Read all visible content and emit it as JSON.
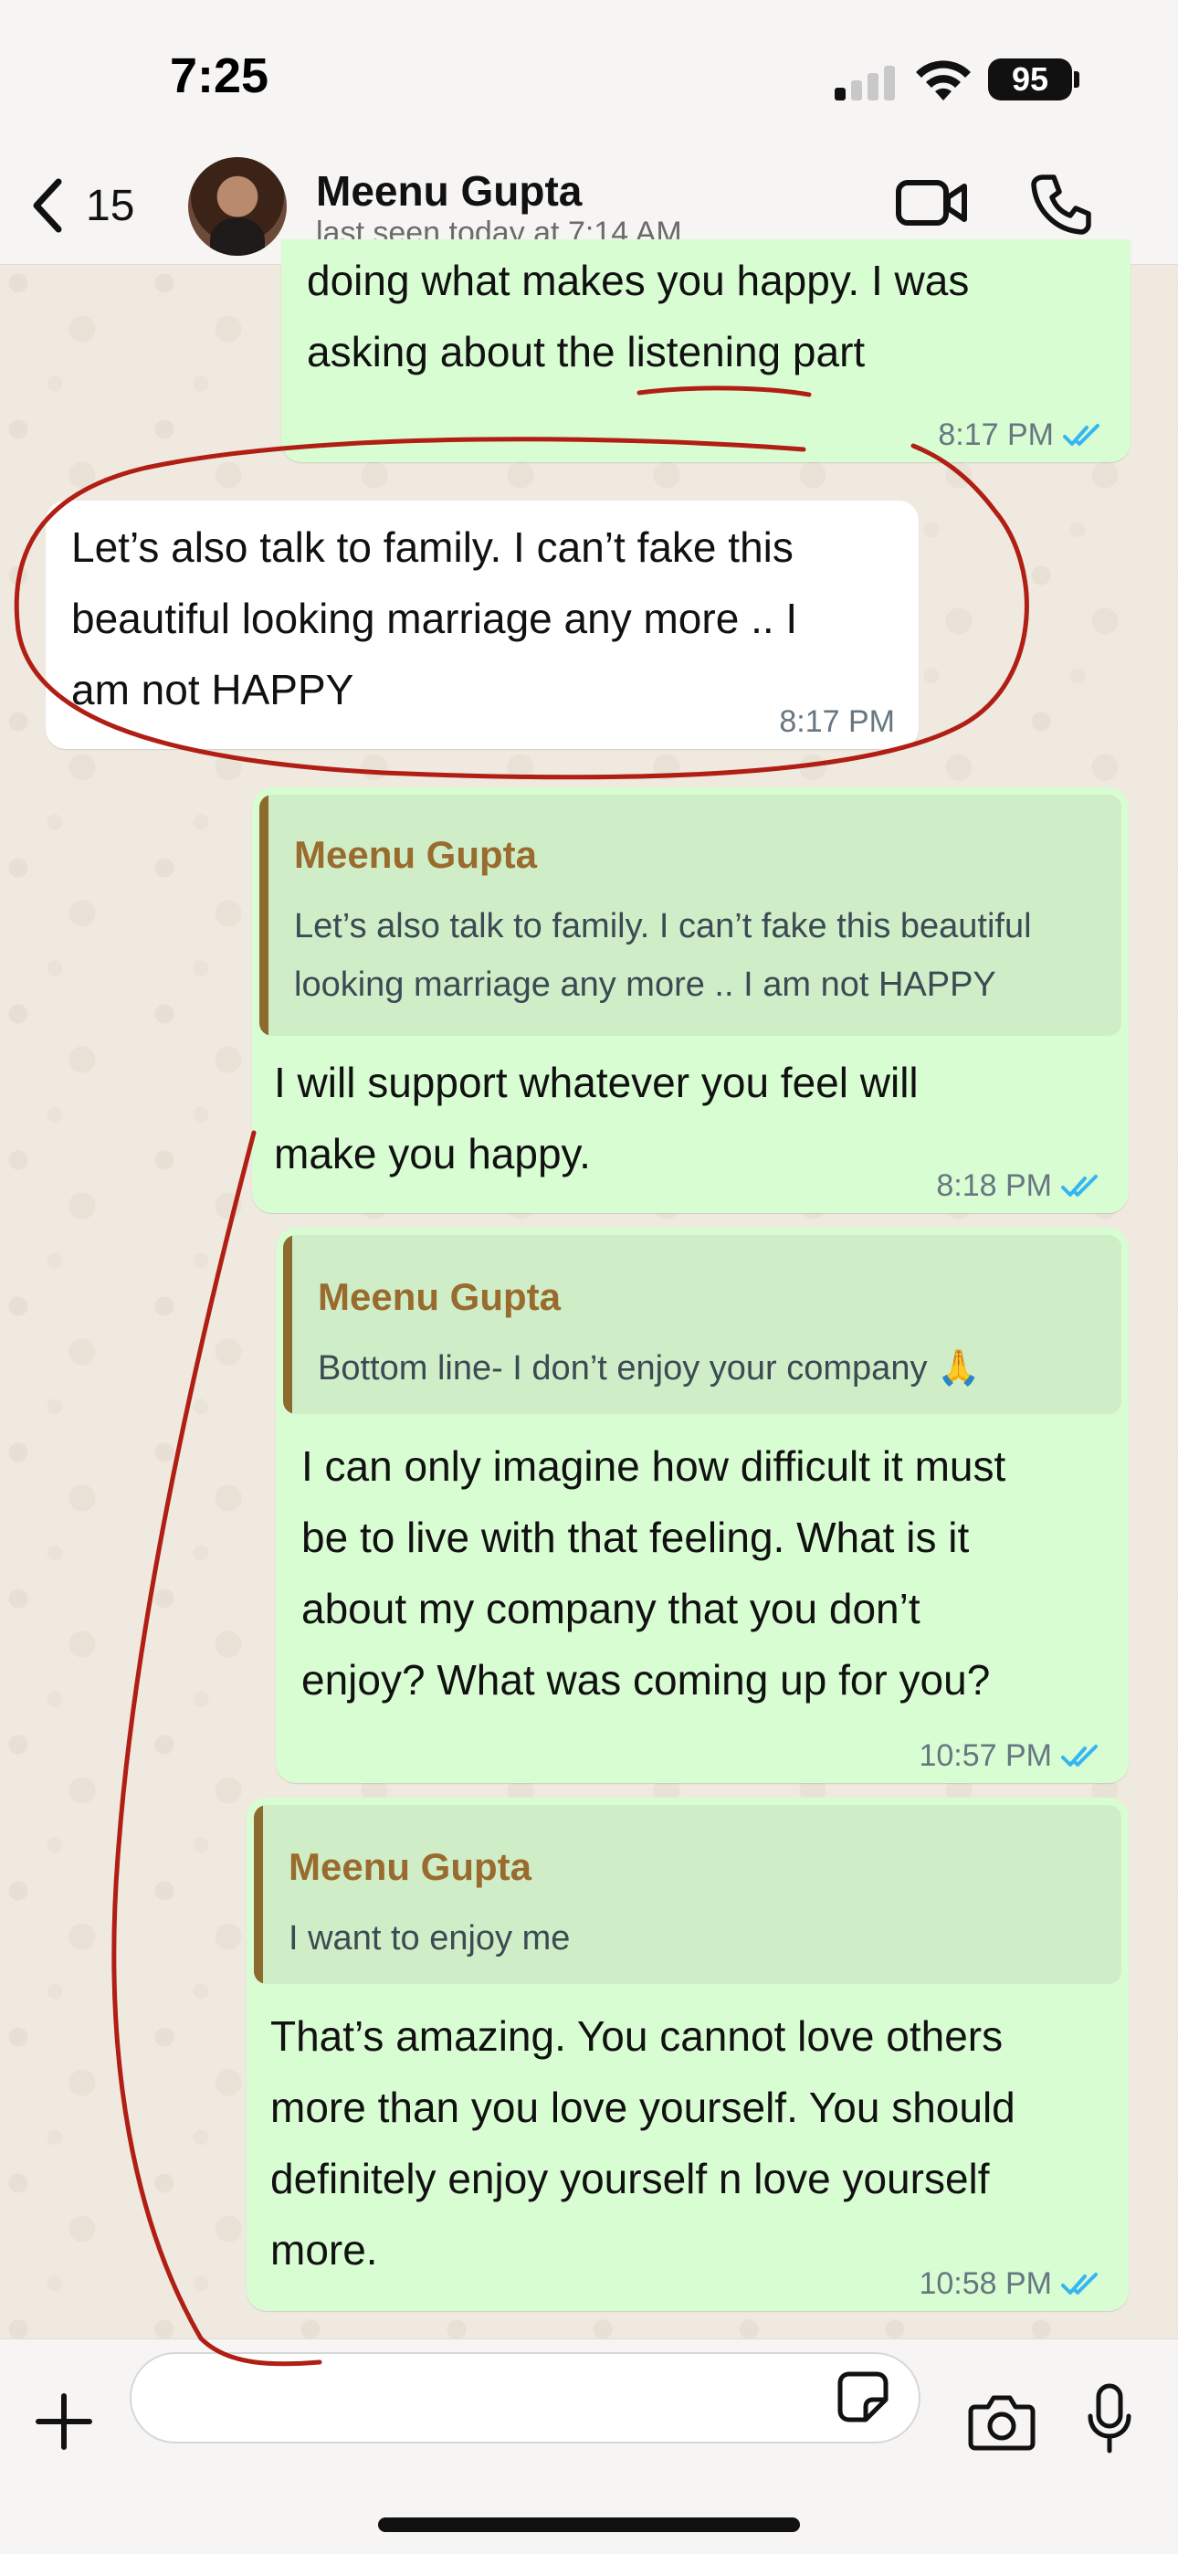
{
  "status_bar": {
    "time": "7:25",
    "battery": "95"
  },
  "header": {
    "back_count": "15",
    "contact_name": "Meenu Gupta",
    "last_seen": "last seen today at 7:14 AM"
  },
  "colors": {
    "outgoing_bubble": "#d9fdd3",
    "incoming_bubble": "#ffffff",
    "quote_author": "#9a6b2e",
    "read_ticks": "#34b7f1",
    "annotation_ink": "#b01e14"
  },
  "messages": [
    {
      "direction": "outgoing",
      "lines": [
        "doing what makes you happy. I was",
        "asking about the listening part"
      ],
      "time": "8:17 PM",
      "status": "read"
    },
    {
      "direction": "incoming",
      "lines": [
        "Let’s also talk to family. I can’t fake this",
        "beautiful looking marriage any more .. I",
        "am not HAPPY"
      ],
      "time": "8:17 PM"
    },
    {
      "direction": "outgoing",
      "quote": {
        "author": "Meenu Gupta",
        "lines": [
          "Let’s also talk to family. I can’t fake this beautiful",
          "looking marriage any more .. I am not HAPPY"
        ]
      },
      "lines": [
        "I will support whatever you feel will",
        "make you happy."
      ],
      "time": "8:18 PM",
      "status": "read"
    },
    {
      "direction": "outgoing",
      "quote": {
        "author": "Meenu Gupta",
        "lines": [
          "Bottom line- I don’t enjoy your company 🙏"
        ]
      },
      "lines": [
        "I can only imagine how difficult it must",
        "be to live with that feeling. What is it",
        "about my company that you don’t",
        "enjoy? What was coming up for you?"
      ],
      "time": "10:57 PM",
      "status": "read"
    },
    {
      "direction": "outgoing",
      "quote": {
        "author": "Meenu Gupta",
        "lines": [
          "I want to enjoy me"
        ]
      },
      "lines": [
        "That’s amazing. You cannot love others",
        "more than you love yourself. You should",
        "definitely enjoy yourself n love yourself",
        "more."
      ],
      "time": "10:58 PM",
      "status": "read"
    }
  ],
  "input": {
    "placeholder": ""
  },
  "icons": {
    "back": "chevron-left-icon",
    "video": "video-call-icon",
    "call": "phone-icon",
    "attach": "plus-icon",
    "sticker": "sticker-icon",
    "camera": "camera-icon",
    "mic": "microphone-icon"
  }
}
